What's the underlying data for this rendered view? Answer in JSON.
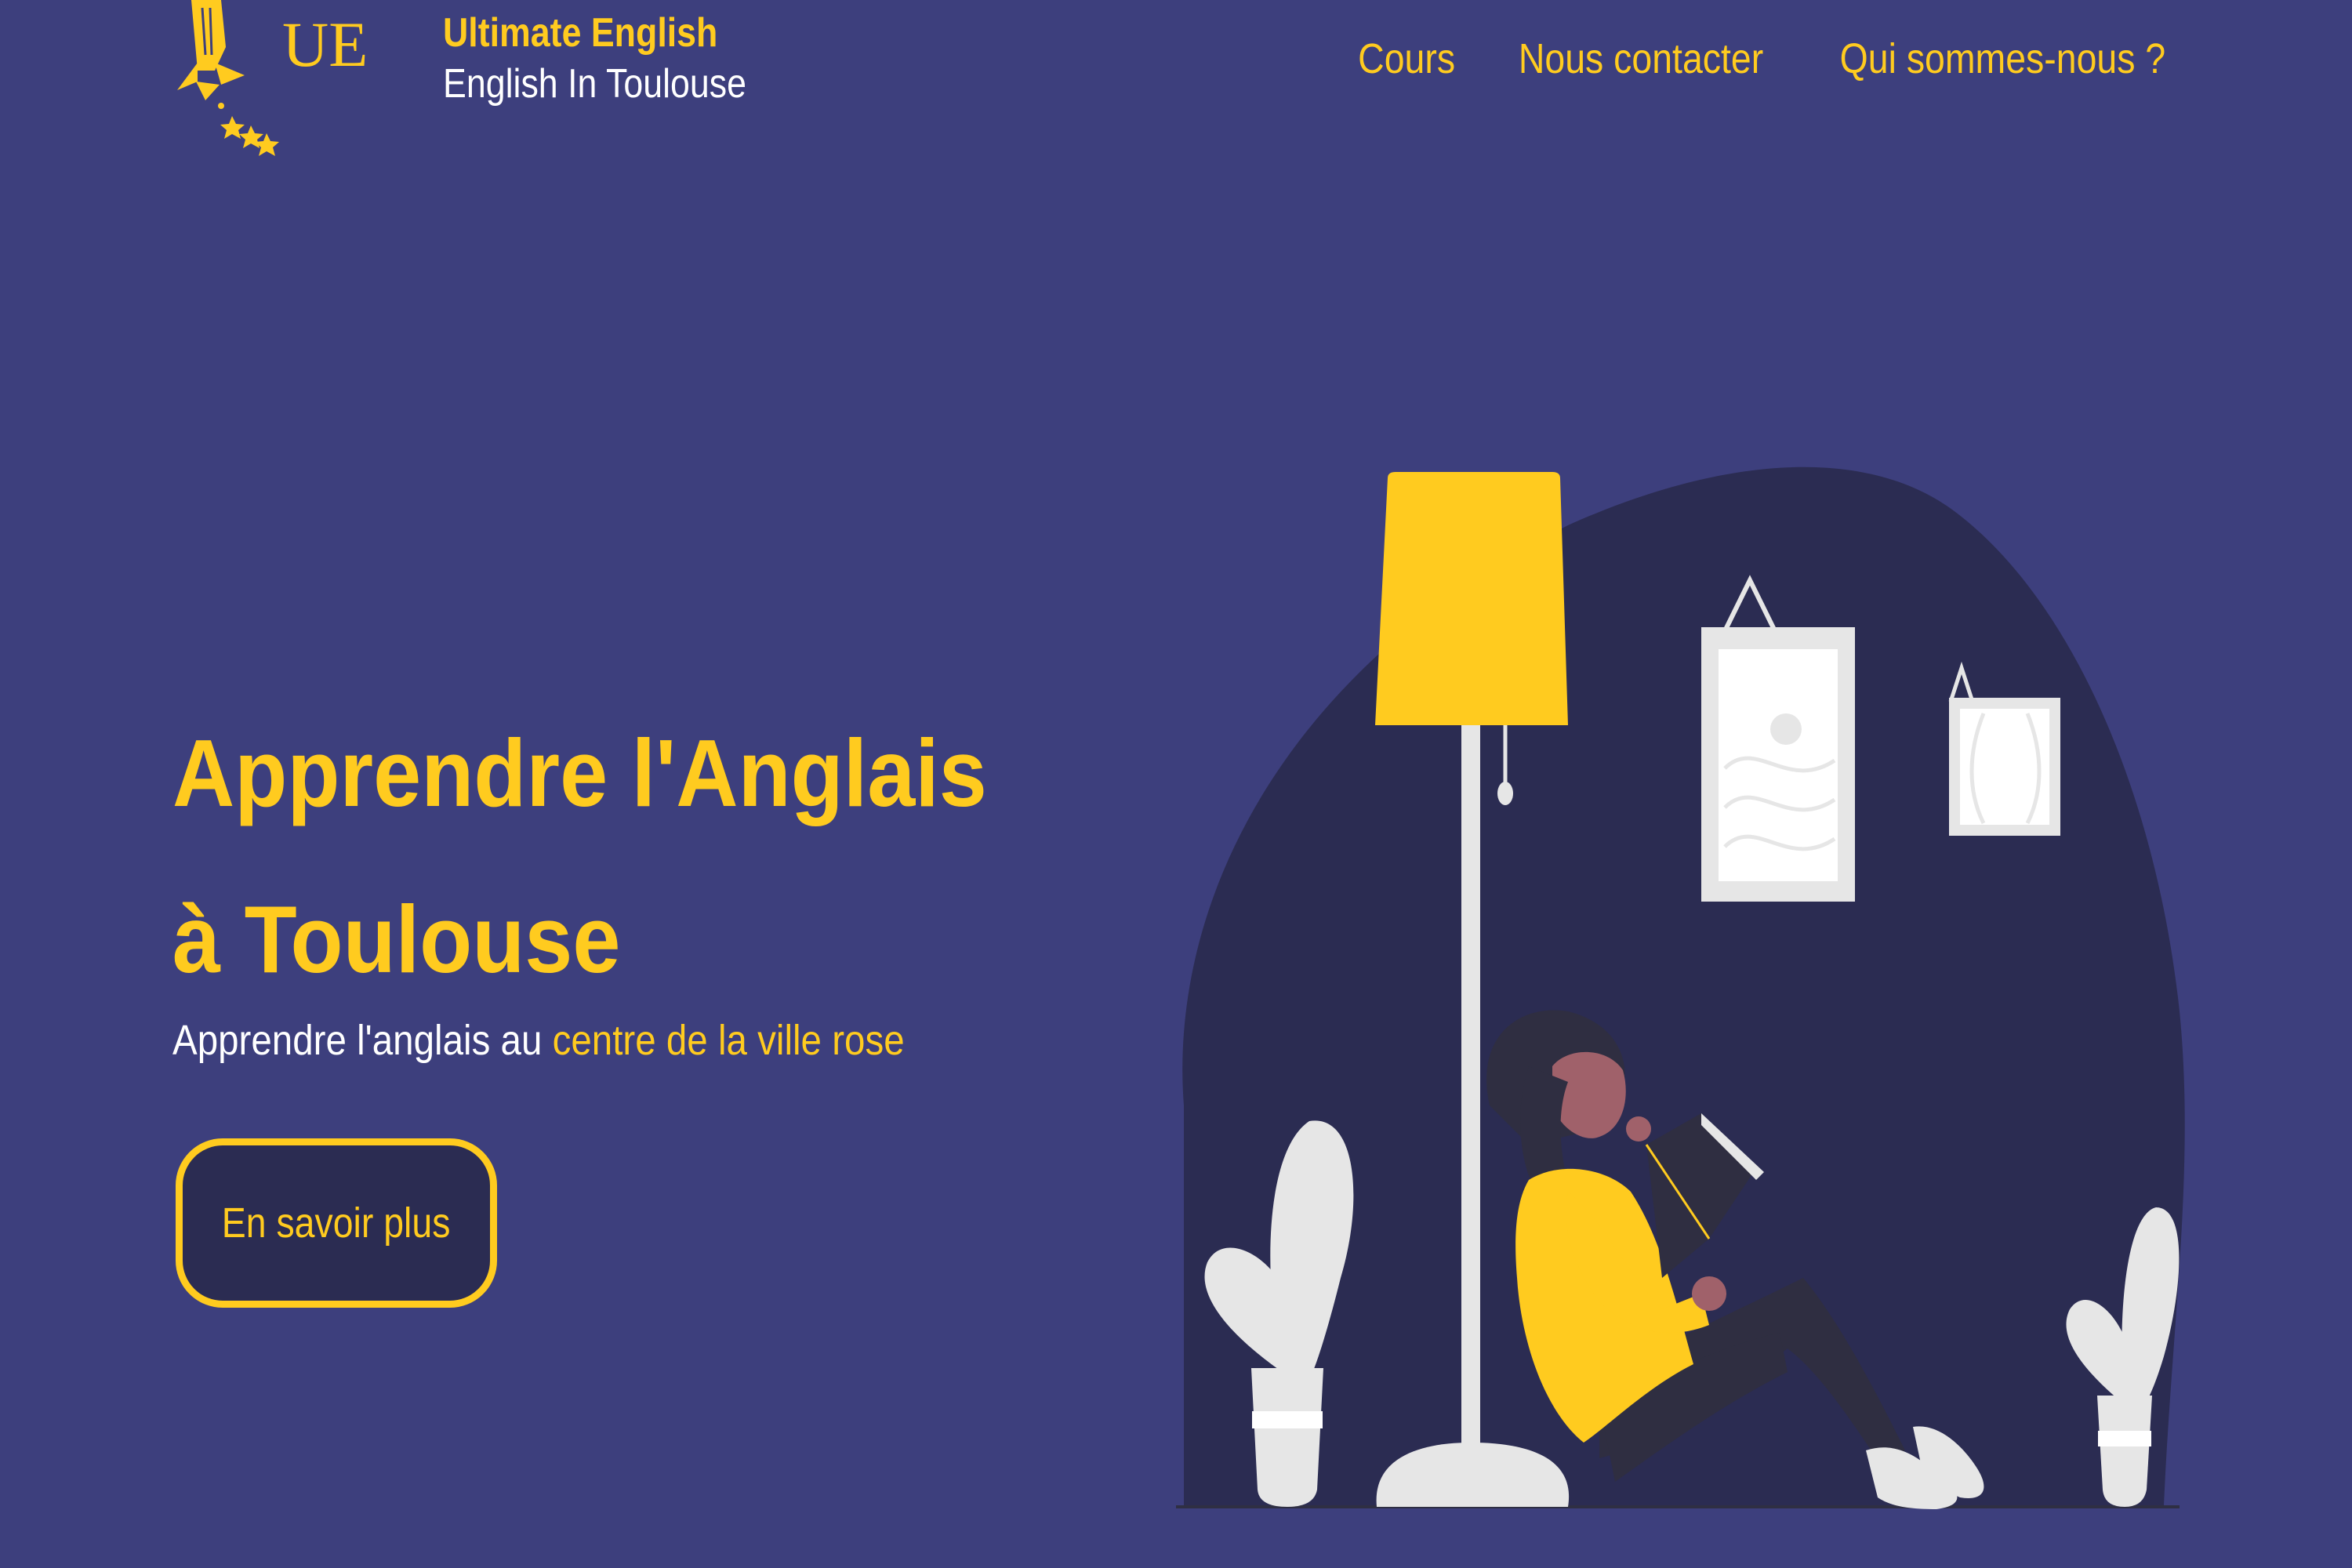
{
  "header": {
    "logo_text": "UE",
    "brand_name": "Ultimate English",
    "brand_tagline": "English In Toulouse"
  },
  "nav": {
    "items": [
      {
        "label": "Cours"
      },
      {
        "label": "Nous contacter"
      },
      {
        "label": "Qui sommes-nous ?"
      }
    ]
  },
  "hero": {
    "title": "Apprendre l'Anglais à Toulouse",
    "subtitle_prefix": "Apprendre l'anglais au ",
    "subtitle_highlight": "centre de la ville rose",
    "cta_label": "En savoir plus"
  },
  "colors": {
    "background": "#3d3f7d",
    "accent": "#ffcb1f",
    "dark_blob": "#2b2c52",
    "light_gray": "#e6e6e6"
  },
  "icons": [
    "rocket-logo-icon",
    "star-icon"
  ]
}
